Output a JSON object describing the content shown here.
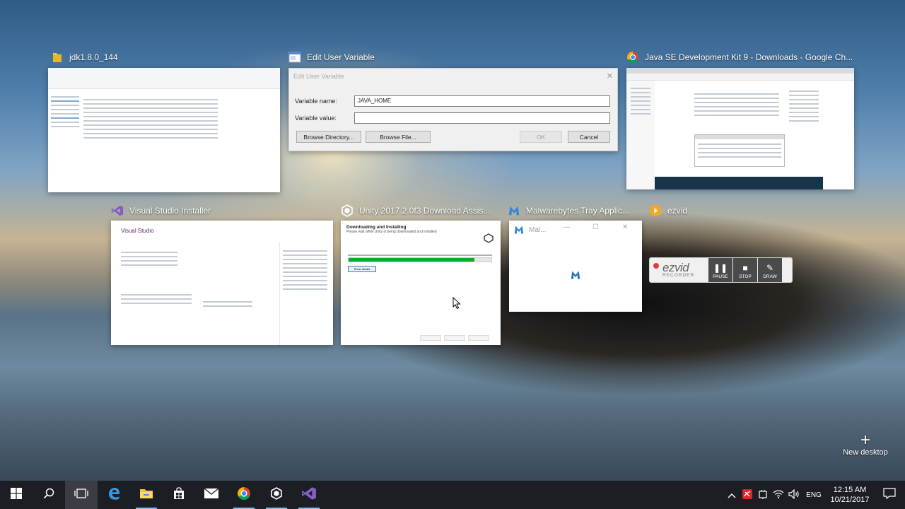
{
  "windows": [
    {
      "title": "jdk1.8.0_144",
      "icon": "folder-icon"
    },
    {
      "title": "Edit User Variable",
      "icon": "dialog-icon"
    },
    {
      "title": "Java SE Development Kit 9 - Downloads - Google Ch...",
      "icon": "chrome-icon"
    },
    {
      "title": "Visual Studio Installer",
      "icon": "visual-studio-icon"
    },
    {
      "title": "Unity 2017.2.0f3 Download Assis...",
      "icon": "unity-icon"
    },
    {
      "title": "Malwarebytes Tray Applic...",
      "icon": "malwarebytes-icon"
    },
    {
      "title": "ezvid",
      "icon": "ezvid-icon"
    }
  ],
  "edit_user_variable": {
    "dialog_title": "Edit User Variable",
    "name_label": "Variable name:",
    "name_value": "JAVA_HOME",
    "value_label": "Variable value:",
    "value_value": "",
    "browse_directory": "Browse Directory...",
    "browse_file": "Browse File...",
    "ok": "OK",
    "cancel": "Cancel"
  },
  "vs_installer": {
    "title": "Visual Studio"
  },
  "unity": {
    "heading": "Downloading and Installing",
    "subheading": "Please wait while Unity is being downloaded and installed",
    "progress": 0.88,
    "show_details": "Show details"
  },
  "malwarebytes": {
    "title": "Mal..."
  },
  "ezvid": {
    "logo": "ezvid",
    "sub": "RECORDER",
    "pause": "PAUSE",
    "stop": "STOP",
    "draw": "DRAW"
  },
  "new_desktop": "New desktop",
  "taskbar": {
    "apps": [
      "start-icon",
      "search-icon",
      "task-view-icon",
      "edge-icon",
      "file-explorer-icon",
      "store-icon",
      "mail-icon",
      "chrome-icon",
      "unity-icon",
      "visual-studio-icon"
    ],
    "language": "ENG",
    "time": "12:15 AM",
    "date": "10/21/2017"
  },
  "colors": {
    "taskbar": "#1b1f24",
    "progress_green": "#06b025",
    "vs_purple": "#68217a",
    "accent_blue": "#0078d7"
  }
}
